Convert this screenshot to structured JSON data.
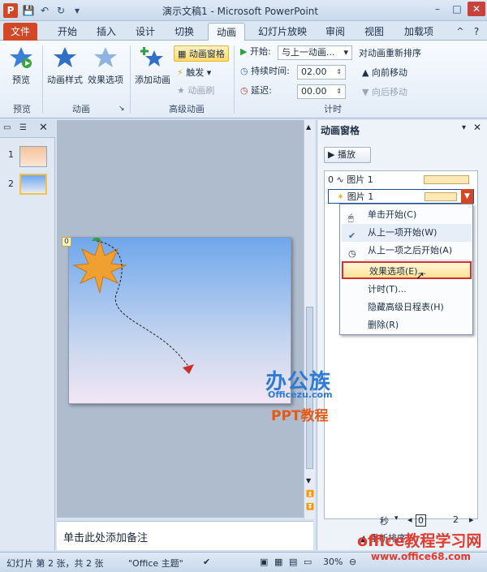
{
  "window": {
    "title": "演示文稿1 - Microsoft PowerPoint",
    "app_icon": "P",
    "minimize": "–",
    "maximize": "□",
    "close": "✕"
  },
  "qat": {
    "save": "💾",
    "undo": "↶",
    "redo": "↻",
    "customize": "▾"
  },
  "tabs": [
    {
      "label": "文件"
    },
    {
      "label": "开始"
    },
    {
      "label": "插入"
    },
    {
      "label": "设计"
    },
    {
      "label": "切换"
    },
    {
      "label": "动画"
    },
    {
      "label": "幻灯片放映"
    },
    {
      "label": "审阅"
    },
    {
      "label": "视图"
    },
    {
      "label": "加载项"
    }
  ],
  "ribbon": {
    "preview": {
      "label": "预览",
      "group": "预览"
    },
    "animation_styles": {
      "label": "动画样式"
    },
    "effect_options": {
      "label": "效果选项"
    },
    "animation_group": "动画",
    "add_animation": {
      "label": "添加动画"
    },
    "animation_pane": {
      "label": "动画窗格"
    },
    "trigger": {
      "label": "触发"
    },
    "animation_painter": {
      "label": "动画刷"
    },
    "advanced_group": "高级动画",
    "start": {
      "label": "开始:",
      "value": "与上一动画..."
    },
    "duration": {
      "label": "持续时间:",
      "value": "02.00"
    },
    "delay": {
      "label": "延迟:",
      "value": "00.00"
    },
    "timing_group": "计时",
    "reorder_title": "对动画重新排序",
    "move_earlier": "向前移动",
    "move_later": "向后移动"
  },
  "slides": [
    {
      "number": "1"
    },
    {
      "number": "2"
    }
  ],
  "slide_tag": "0",
  "notes_placeholder": "单击此处添加备注",
  "anim_pane": {
    "title": "动画窗格",
    "play": "播放",
    "items": [
      {
        "index": "0",
        "name": "图片 1"
      },
      {
        "index": "",
        "name": "图片 1"
      }
    ],
    "seconds": "秒",
    "timeline_ticks": [
      "0",
      "2"
    ],
    "reorder": "重新排序"
  },
  "menu": {
    "items": [
      {
        "label": "单击开始(C)"
      },
      {
        "label": "从上一项开始(W)"
      },
      {
        "label": "从上一项之后开始(A)"
      },
      {
        "label": "效果选项(E)..."
      },
      {
        "label": "计时(T)..."
      },
      {
        "label": "隐藏高级日程表(H)"
      },
      {
        "label": "删除(R)"
      }
    ]
  },
  "status": {
    "slide_info": "幻灯片 第 2 张，共 2 张",
    "theme": "\"Office 主题\"",
    "zoom": "30%"
  },
  "watermarks": {
    "brand": "办公族",
    "brand_url": "Officezu.com",
    "ppt": "PPT教程",
    "site": "office教程学习网",
    "site_url": "www.office68.com"
  }
}
